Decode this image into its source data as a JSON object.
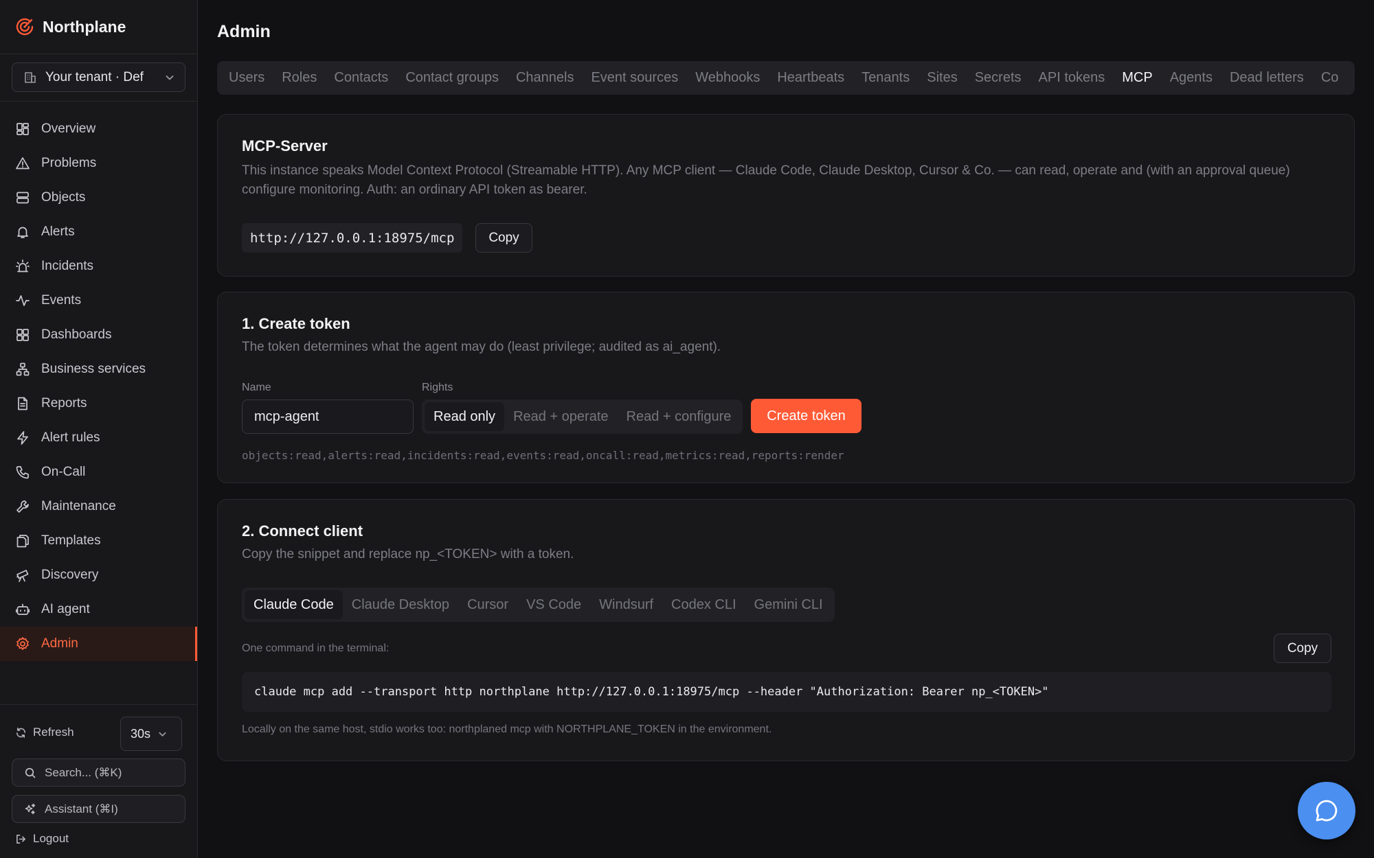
{
  "app": {
    "name": "Northplane"
  },
  "tenant": {
    "label": "Your tenant · Def"
  },
  "nav": [
    {
      "label": "Overview",
      "icon": "grid-icon"
    },
    {
      "label": "Problems",
      "icon": "warning-icon"
    },
    {
      "label": "Objects",
      "icon": "server-icon"
    },
    {
      "label": "Alerts",
      "icon": "bell-icon"
    },
    {
      "label": "Incidents",
      "icon": "siren-icon"
    },
    {
      "label": "Events",
      "icon": "activity-icon"
    },
    {
      "label": "Dashboards",
      "icon": "dashboard-icon"
    },
    {
      "label": "Business services",
      "icon": "network-icon"
    },
    {
      "label": "Reports",
      "icon": "document-icon"
    },
    {
      "label": "Alert rules",
      "icon": "bolt-icon"
    },
    {
      "label": "On-Call",
      "icon": "phone-icon"
    },
    {
      "label": "Maintenance",
      "icon": "wrench-icon"
    },
    {
      "label": "Templates",
      "icon": "copy-icon"
    },
    {
      "label": "Discovery",
      "icon": "telescope-icon"
    },
    {
      "label": "AI agent",
      "icon": "bot-icon"
    },
    {
      "label": "Admin",
      "icon": "gear-icon",
      "active": true
    }
  ],
  "footer": {
    "refresh_label": "Refresh",
    "interval": "30s",
    "search_label": "Search... (⌘K)",
    "assistant_label": "Assistant (⌘I)",
    "logout_label": "Logout"
  },
  "page": {
    "title": "Admin"
  },
  "tabs": [
    {
      "label": "Users"
    },
    {
      "label": "Roles"
    },
    {
      "label": "Contacts"
    },
    {
      "label": "Contact groups"
    },
    {
      "label": "Channels"
    },
    {
      "label": "Event sources"
    },
    {
      "label": "Webhooks"
    },
    {
      "label": "Heartbeats"
    },
    {
      "label": "Tenants"
    },
    {
      "label": "Sites"
    },
    {
      "label": "Secrets"
    },
    {
      "label": "API tokens"
    },
    {
      "label": "MCP",
      "active": true
    },
    {
      "label": "Agents"
    },
    {
      "label": "Dead letters"
    },
    {
      "label": "Co"
    }
  ],
  "mcp_server": {
    "title": "MCP-Server",
    "description": "This instance speaks Model Context Protocol (Streamable HTTP). Any MCP client — Claude Code, Claude Desktop, Cursor & Co. — can read, operate and (with an approval queue) configure monitoring. Auth: an ordinary API token as bearer.",
    "url": "http://127.0.0.1:18975/mcp",
    "copy_label": "Copy"
  },
  "create_token": {
    "title": "1. Create token",
    "description": "The token determines what the agent may do (least privilege; audited as ai_agent).",
    "name_label": "Name",
    "name_value": "mcp-agent",
    "rights_label": "Rights",
    "rights": [
      {
        "label": "Read only",
        "active": true
      },
      {
        "label": "Read + operate"
      },
      {
        "label": "Read + configure"
      }
    ],
    "button_label": "Create token",
    "scopes": "objects:read,alerts:read,incidents:read,events:read,oncall:read,metrics:read,reports:render"
  },
  "connect_client": {
    "title": "2. Connect client",
    "description": "Copy the snippet and replace np_<TOKEN> with a token.",
    "clients": [
      {
        "label": "Claude Code",
        "active": true
      },
      {
        "label": "Claude Desktop"
      },
      {
        "label": "Cursor"
      },
      {
        "label": "VS Code"
      },
      {
        "label": "Windsurf"
      },
      {
        "label": "Codex CLI"
      },
      {
        "label": "Gemini CLI"
      }
    ],
    "hint": "One command in the terminal:",
    "copy_label": "Copy",
    "command": "claude mcp add --transport http northplane http://127.0.0.1:18975/mcp --header \"Authorization: Bearer np_<TOKEN>\"",
    "footnote": "Locally on the same host, stdio works too: northplaned mcp with NORTHPLANE_TOKEN in the environment."
  },
  "colors": {
    "accent": "#ff5a36",
    "fab": "#4b8ff0",
    "background": "#111113",
    "panel": "#18181b"
  }
}
